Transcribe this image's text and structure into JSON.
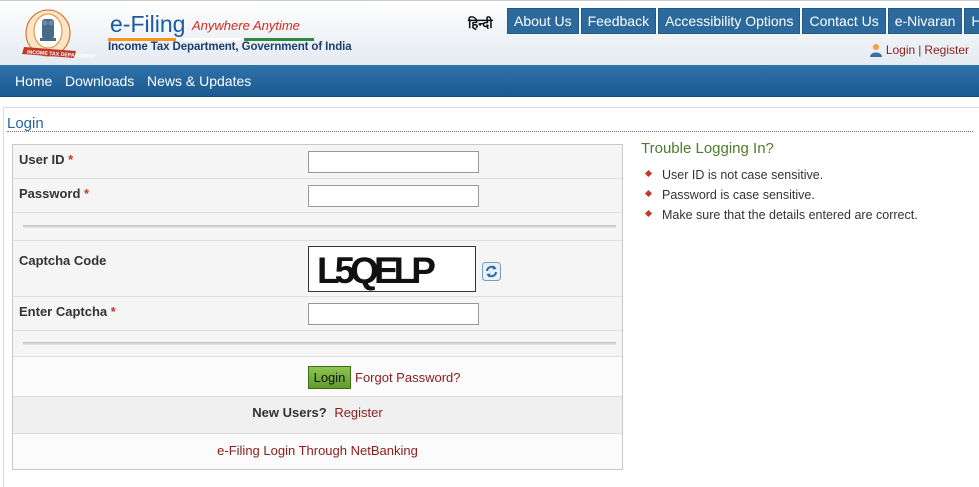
{
  "header": {
    "brand_title": "e-Filing",
    "brand_tagline": "Anywhere Anytime",
    "brand_department": "Income Tax Department, Government of India",
    "emblem_text": "INCOME TAX DEPARTMENT",
    "language_link": "हिन्दी",
    "top_nav": [
      "About Us",
      "Feedback",
      "Accessibility Options",
      "Contact Us",
      "e-Nivaran",
      "Help"
    ],
    "login_link": "Login",
    "separator": "|",
    "register_link": "Register"
  },
  "main_nav": {
    "items": [
      "Home",
      "Downloads",
      "News & Updates"
    ]
  },
  "login": {
    "heading": "Login",
    "user_id_label": "User ID",
    "password_label": "Password",
    "captcha_label": "Captcha Code",
    "captcha_value": "L5QELP",
    "enter_captcha_label": "Enter Captcha",
    "required_mark": "*",
    "user_id_value": "",
    "password_value": "",
    "enter_captcha_value": "",
    "login_button": "Login",
    "forgot_password": "Forgot Password?",
    "new_users_label": "New Users?",
    "register_link": "Register",
    "netbanking_link": "e-Filing Login Through NetBanking"
  },
  "trouble": {
    "title": "Trouble Logging In?",
    "tips": [
      "User ID is not case sensitive.",
      "Password is case sensitive.",
      "Make sure that the details entered are correct."
    ]
  },
  "colors": {
    "nav_blue": "#2c6a9e",
    "link_red": "#8b1c1c",
    "heading_blue": "#2a66a3",
    "trouble_green": "#4f7d2a",
    "login_button_green": "#7ab544"
  }
}
